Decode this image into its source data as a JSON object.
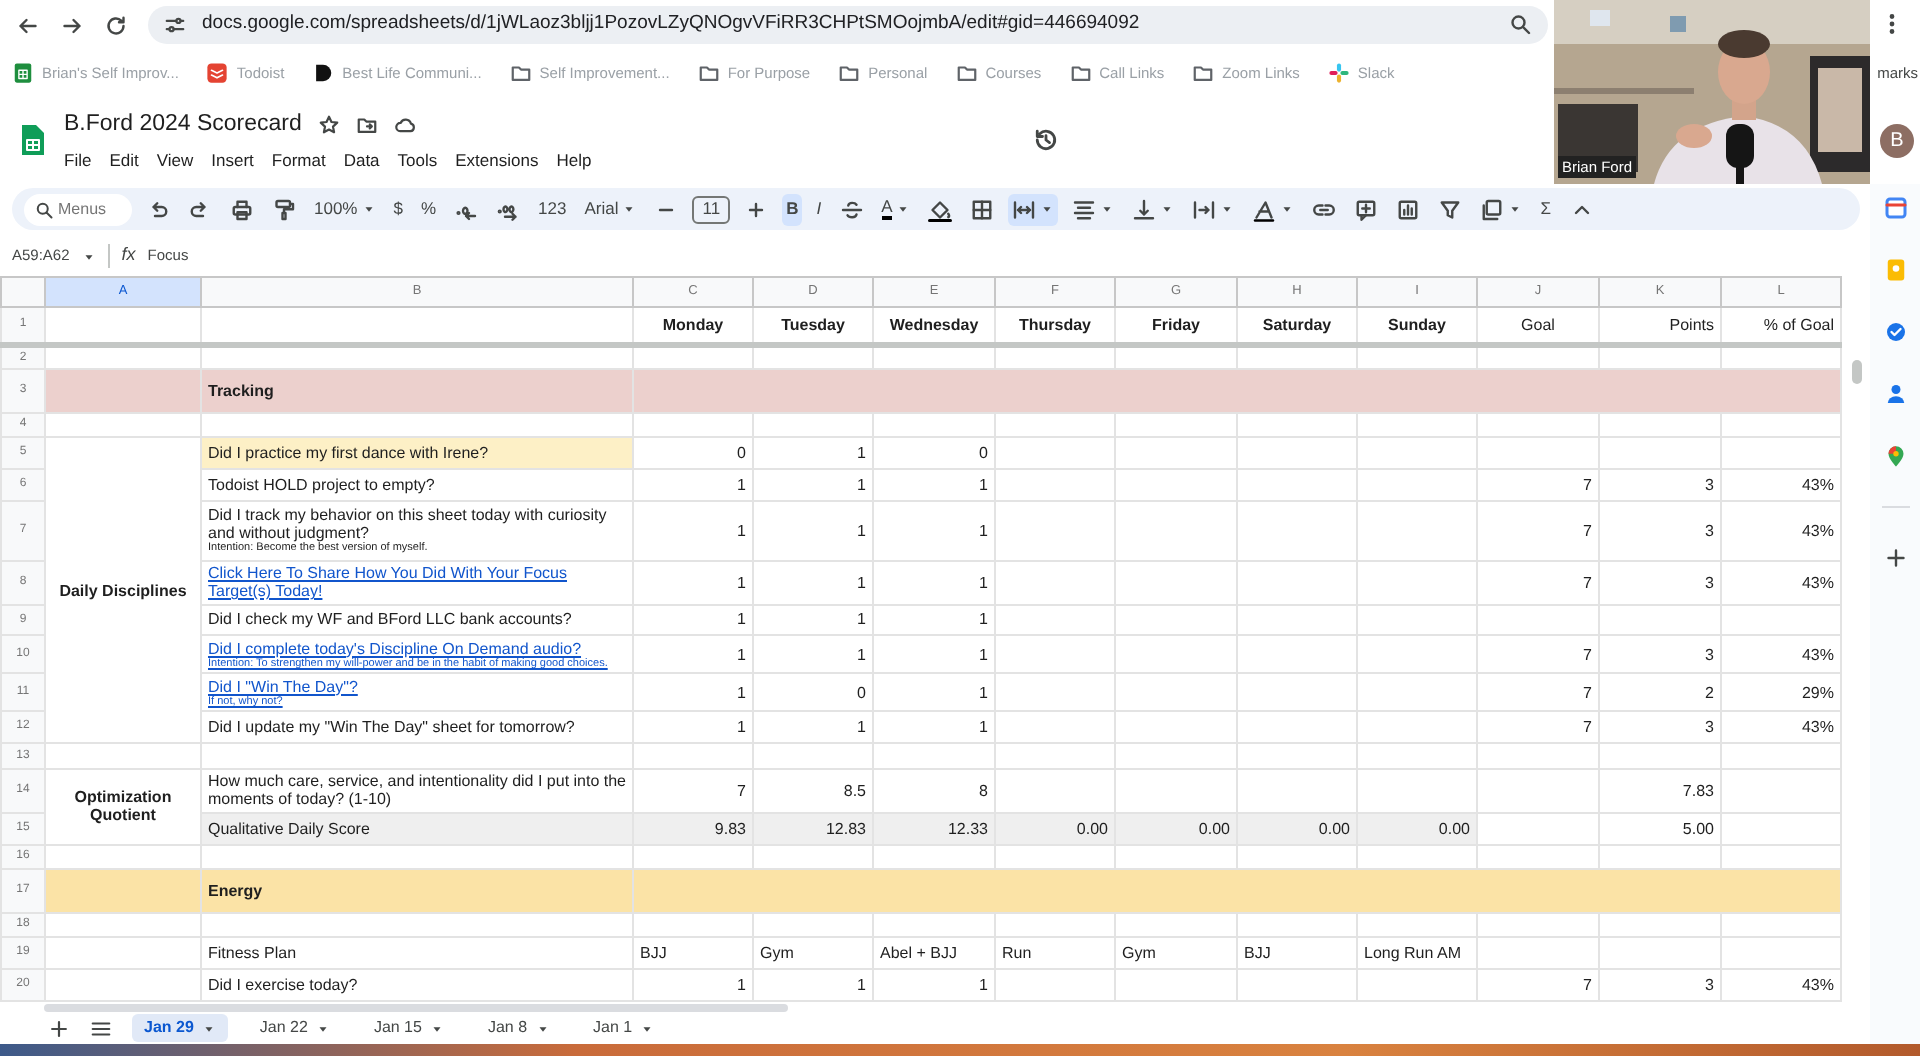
{
  "browser": {
    "url": "docs.google.com/spreadsheets/d/1jWLaoz3bljj1PozovLZyQNOgvVFiRR3CHPtSMOojmbA/edit#gid=446694092",
    "bookmarks": [
      {
        "kind": "sheets",
        "label": "Brian's Self Improv..."
      },
      {
        "kind": "todoist",
        "label": "Todoist"
      },
      {
        "kind": "dark",
        "label": "Best Life Communi..."
      },
      {
        "kind": "folder",
        "label": "Self Improvement..."
      },
      {
        "kind": "folder",
        "label": "For Purpose"
      },
      {
        "kind": "folder",
        "label": "Personal"
      },
      {
        "kind": "folder",
        "label": "Courses"
      },
      {
        "kind": "folder",
        "label": "Call Links"
      },
      {
        "kind": "folder",
        "label": "Zoom Links"
      },
      {
        "kind": "slack",
        "label": "Slack"
      }
    ],
    "bookmarks_end": "marks"
  },
  "webcam": {
    "kind": "picture",
    "name": "Brian Ford"
  },
  "document": {
    "title": "B.Ford 2024 Scorecard",
    "menus": [
      "File",
      "Edit",
      "View",
      "Insert",
      "Format",
      "Data",
      "Tools",
      "Extensions",
      "Help"
    ],
    "avatar": "B"
  },
  "toolbar": [
    {
      "kind": "search",
      "placeholder": "Menus"
    },
    {
      "kind": "undo",
      "on": false
    },
    {
      "kind": "redo",
      "on": false
    },
    {
      "kind": "print",
      "on": false
    },
    {
      "kind": "paint",
      "on": false
    },
    {
      "kind": "dropdown",
      "label": "100%",
      "on": false
    },
    {
      "kind": "text",
      "label": "$",
      "on": false
    },
    {
      "kind": "text",
      "label": "%",
      "on": false
    },
    {
      "kind": "decrease",
      "on": false
    },
    {
      "kind": "increase",
      "on": false
    },
    {
      "kind": "text",
      "label": "123",
      "on": false
    },
    {
      "kind": "dropdown",
      "label": "Arial",
      "on": false
    },
    {
      "kind": "minus",
      "on": false
    },
    {
      "kind": "size",
      "label": "11",
      "on": false
    },
    {
      "kind": "plus",
      "on": false
    },
    {
      "kind": "bold",
      "label": "B",
      "on": true
    },
    {
      "kind": "italic",
      "label": "I",
      "on": false
    },
    {
      "kind": "strike",
      "on": false
    },
    {
      "kind": "textcolor",
      "label": "A",
      "on": false
    },
    {
      "kind": "fill",
      "on": false
    },
    {
      "kind": "borders",
      "on": false
    },
    {
      "kind": "merge",
      "on": true
    },
    {
      "kind": "align",
      "on": false
    },
    {
      "kind": "valign",
      "on": false
    },
    {
      "kind": "wrap",
      "on": false
    },
    {
      "kind": "rotate",
      "on": false
    },
    {
      "kind": "link",
      "on": false
    },
    {
      "kind": "comment",
      "on": false
    },
    {
      "kind": "chart",
      "on": false
    },
    {
      "kind": "filter",
      "on": false
    },
    {
      "kind": "views",
      "on": false
    },
    {
      "kind": "sum",
      "label": "Σ",
      "on": false
    },
    {
      "kind": "collapse",
      "on": false
    }
  ],
  "formula_bar": {
    "name_box": "A59:A62",
    "symbol": "fx",
    "content": "Focus"
  },
  "sheet": {
    "columns": [
      {
        "letter": "A",
        "selected": true
      },
      {
        "letter": "B",
        "selected": false
      },
      {
        "letter": "C",
        "selected": false
      },
      {
        "letter": "D",
        "selected": false
      },
      {
        "letter": "E",
        "selected": false
      },
      {
        "letter": "F",
        "selected": false
      },
      {
        "letter": "G",
        "selected": false
      },
      {
        "letter": "H",
        "selected": false
      },
      {
        "letter": "I",
        "selected": false
      },
      {
        "letter": "J",
        "selected": false
      },
      {
        "letter": "K",
        "selected": false
      },
      {
        "letter": "L",
        "selected": false
      }
    ],
    "rows": [
      {
        "num": "1",
        "kind": "header",
        "cells": {
          "C": "Monday",
          "D": "Tuesday",
          "E": "Wednesday",
          "F": "Thursday",
          "G": "Friday",
          "H": "Saturday",
          "I": "Sunday",
          "J": "Goal",
          "K": "Points",
          "L": "% of Goal"
        }
      },
      {
        "num": "2",
        "kind": "blank"
      },
      {
        "num": "3",
        "kind": "section",
        "title": "Tracking",
        "color": "#ecd0cd"
      },
      {
        "num": "4",
        "kind": "blank"
      },
      {
        "kind": "group",
        "label": "Daily Disciplines",
        "rows": [
          {
            "num": "5",
            "kind": "data",
            "b": {
              "text": "Did I practice my first dance with Irene?",
              "link": false,
              "highlighted": true
            },
            "cells": {
              "C": "0",
              "D": "1",
              "E": "0"
            }
          },
          {
            "num": "6",
            "kind": "data",
            "b": {
              "text": "Todoist HOLD project to empty?",
              "link": false,
              "highlighted": false
            },
            "cells": {
              "C": "1",
              "D": "1",
              "E": "1",
              "J": "7",
              "K": "3",
              "L": "43%"
            }
          },
          {
            "num": "7",
            "kind": "data",
            "b": {
              "text": "Did I track my behavior on this sheet today with curiosity and without judgment?",
              "note": "Intention: Become the best version of myself.",
              "link": false,
              "highlighted": false
            },
            "cells": {
              "C": "1",
              "D": "1",
              "E": "1",
              "J": "7",
              "K": "3",
              "L": "43%"
            }
          },
          {
            "num": "8",
            "kind": "data",
            "b": {
              "text": "Click Here To Share How You Did With Your Focus Target(s) Today!",
              "link": true,
              "highlighted": false
            },
            "cells": {
              "C": "1",
              "D": "1",
              "E": "1",
              "J": "7",
              "K": "3",
              "L": "43%"
            }
          },
          {
            "num": "9",
            "kind": "data",
            "b": {
              "text": "Did I check my WF and BFord LLC bank accounts?",
              "link": false,
              "highlighted": false
            },
            "cells": {
              "C": "1",
              "D": "1",
              "E": "1"
            }
          },
          {
            "num": "10",
            "kind": "data",
            "b": {
              "text": "Did I complete today's Discipline On Demand audio?",
              "note": "Intention: To strengthen my will-power and be in the habit of making good choices.",
              "link": true,
              "highlighted": false
            },
            "cells": {
              "C": "1",
              "D": "1",
              "E": "1",
              "J": "7",
              "K": "3",
              "L": "43%"
            }
          },
          {
            "num": "11",
            "kind": "data",
            "b": {
              "text": "Did I \"Win The Day\"?",
              "note": "If not, why not?",
              "link": true,
              "highlighted": false
            },
            "cells": {
              "C": "1",
              "D": "0",
              "E": "1",
              "J": "7",
              "K": "2",
              "L": "29%"
            }
          },
          {
            "num": "12",
            "kind": "data",
            "b": {
              "text": "Did I update my \"Win The Day\" sheet for tomorrow?",
              "link": false,
              "highlighted": false
            },
            "cells": {
              "C": "1",
              "D": "1",
              "E": "1",
              "J": "7",
              "K": "3",
              "L": "43%"
            }
          }
        ]
      },
      {
        "num": "13",
        "kind": "blank"
      },
      {
        "kind": "group",
        "label": "Optimization Quotient",
        "rows": [
          {
            "num": "14",
            "kind": "data",
            "b": {
              "text": "How much care, service, and intentionality did I put into the moments of today? (1-10)",
              "link": false,
              "highlighted": false
            },
            "cells": {
              "C": "7",
              "D": "8.5",
              "E": "8",
              "K": "7.83"
            }
          },
          {
            "num": "15",
            "kind": "score",
            "b": {
              "text": "Qualitative Daily Score",
              "link": false,
              "highlighted": false
            },
            "cells": {
              "C": "9.83",
              "D": "12.83",
              "E": "12.33",
              "F": "0.00",
              "G": "0.00",
              "H": "0.00",
              "I": "0.00",
              "K": "5.00"
            }
          }
        ]
      },
      {
        "num": "16",
        "kind": "blank"
      },
      {
        "num": "17",
        "kind": "section",
        "title": "Energy",
        "color": "#fbe3a6"
      },
      {
        "num": "18",
        "kind": "blank"
      },
      {
        "num": "19",
        "kind": "plan",
        "b": {
          "text": "Fitness Plan",
          "link": false,
          "highlighted": false
        },
        "cells": {
          "C": "BJJ",
          "D": "Gym",
          "E": "Abel + BJJ",
          "F": "Run",
          "G": "Gym",
          "H": "BJJ",
          "I": "Long Run AM"
        }
      },
      {
        "num": "20",
        "kind": "data",
        "b": {
          "text": "Did I exercise today?",
          "link": false,
          "highlighted": false
        },
        "cells": {
          "C": "1",
          "D": "1",
          "E": "1",
          "J": "7",
          "K": "3",
          "L": "43%"
        }
      }
    ],
    "tabs": [
      {
        "label": "Jan 29",
        "selected": true
      },
      {
        "label": "Jan 22",
        "selected": false
      },
      {
        "label": "Jan 15",
        "selected": false
      },
      {
        "label": "Jan 8",
        "selected": false
      },
      {
        "label": "Jan 1",
        "selected": false
      }
    ]
  }
}
